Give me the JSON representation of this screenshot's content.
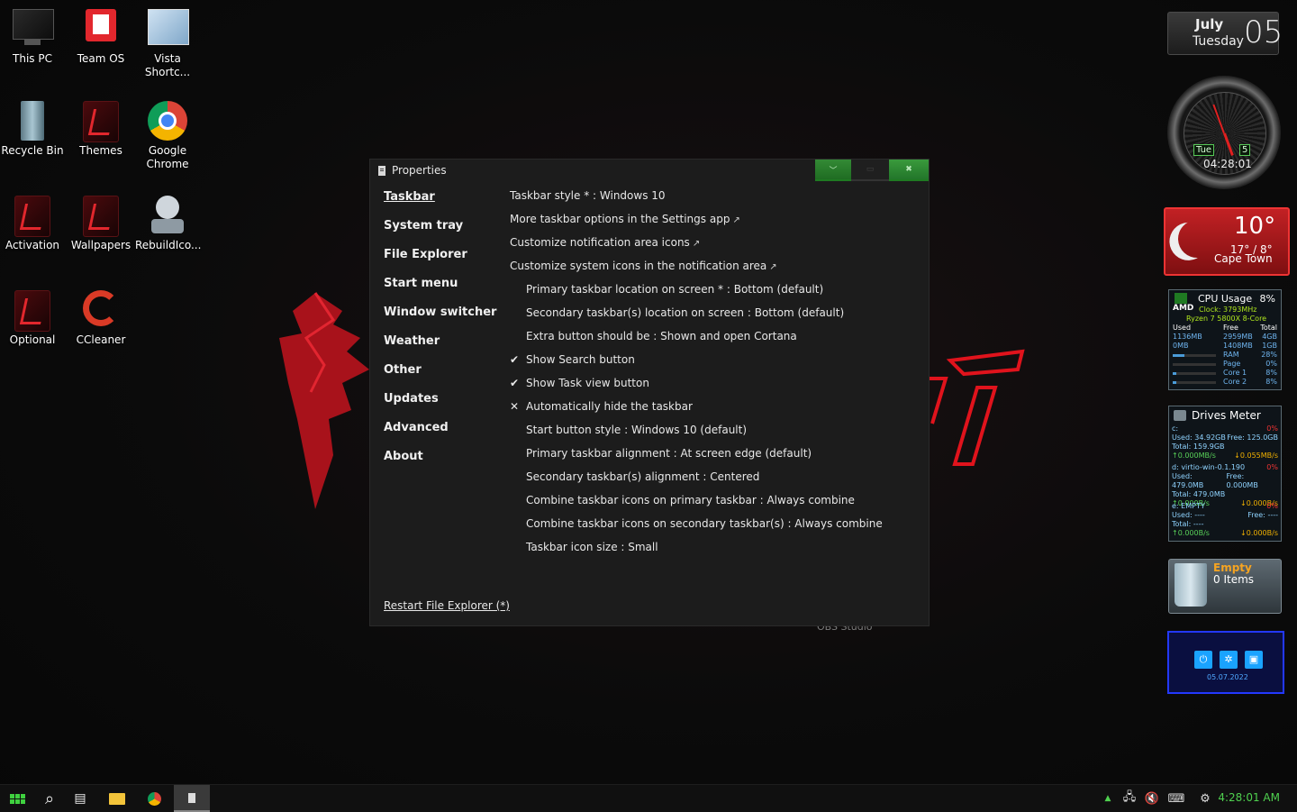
{
  "desktop": {
    "icons": [
      {
        "label": "This PC",
        "icon": "monitor-icon"
      },
      {
        "label": "Team OS",
        "icon": "team-os-icon"
      },
      {
        "label": "Vista Shortc...",
        "icon": "vista-shortcut-icon"
      },
      {
        "label": "Recycle Bin",
        "icon": "recycle-bin-icon"
      },
      {
        "label": "Themes",
        "icon": "themes-icon"
      },
      {
        "label": "Google Chrome",
        "icon": "chrome-icon"
      },
      {
        "label": "Activation",
        "icon": "activation-icon"
      },
      {
        "label": "Wallpapers",
        "icon": "wallpapers-icon"
      },
      {
        "label": "RebuildIco...",
        "icon": "rebuild-icon"
      },
      {
        "label": "Optional",
        "icon": "optional-icon"
      },
      {
        "label": "CCleaner",
        "icon": "ccleaner-icon"
      }
    ],
    "obs_label": "OBS Studio"
  },
  "dialog": {
    "title": "Properties",
    "nav": [
      "Taskbar",
      "System tray",
      "File Explorer",
      "Start menu",
      "Window switcher",
      "Weather",
      "Other",
      "Updates",
      "Advanced",
      "About"
    ],
    "active_nav": "Taskbar",
    "options": [
      {
        "text": "Taskbar style * : Windows 10",
        "link": false,
        "indent": false,
        "mark": ""
      },
      {
        "text": "More taskbar options in the Settings app",
        "link": true,
        "indent": false,
        "mark": ""
      },
      {
        "text": "Customize notification area icons",
        "link": true,
        "indent": false,
        "mark": ""
      },
      {
        "text": "Customize system icons in the notification area",
        "link": true,
        "indent": false,
        "mark": ""
      },
      {
        "text": "Primary taskbar location on screen * : Bottom (default)",
        "link": false,
        "indent": true,
        "mark": ""
      },
      {
        "text": "Secondary taskbar(s) location on screen : Bottom (default)",
        "link": false,
        "indent": true,
        "mark": ""
      },
      {
        "text": "Extra button should be : Shown and open Cortana",
        "link": false,
        "indent": true,
        "mark": ""
      },
      {
        "text": "Show Search button",
        "link": false,
        "indent": true,
        "mark": "✔"
      },
      {
        "text": "Show Task view button",
        "link": false,
        "indent": true,
        "mark": "✔"
      },
      {
        "text": "Automatically hide the taskbar",
        "link": false,
        "indent": true,
        "mark": "✕"
      },
      {
        "text": "Start button style : Windows 10 (default)",
        "link": false,
        "indent": true,
        "mark": ""
      },
      {
        "text": "Primary taskbar alignment : At screen edge (default)",
        "link": false,
        "indent": true,
        "mark": ""
      },
      {
        "text": "Secondary taskbar(s) alignment : Centered",
        "link": false,
        "indent": true,
        "mark": ""
      },
      {
        "text": "Combine taskbar icons on primary taskbar : Always combine",
        "link": false,
        "indent": true,
        "mark": ""
      },
      {
        "text": "Combine taskbar icons on secondary taskbar(s) : Always combine",
        "link": false,
        "indent": true,
        "mark": ""
      },
      {
        "text": "Taskbar icon size : Small",
        "link": false,
        "indent": true,
        "mark": ""
      }
    ],
    "restart_link": "Restart File Explorer (*)",
    "ext_glyph": "↗"
  },
  "widgets": {
    "date": {
      "month": "July",
      "weekday": "Tuesday",
      "day": "05"
    },
    "clock": {
      "day": "Tue",
      "num": "5",
      "time": "04:28:01"
    },
    "weather": {
      "temp": "10°",
      "range": "17° / 8°",
      "city": "Cape Town"
    },
    "cpu": {
      "title": "CPU Usage",
      "percent": "8%",
      "brand": "AMD",
      "clock": "Clock: 3793MHz",
      "model": "Ryzen 7 5800X 8-Core",
      "header": [
        "Used",
        "Free",
        "Total"
      ],
      "rows": [
        {
          "used": "1136MB",
          "free": "2959MB",
          "total": "4GB"
        },
        {
          "used": "0MB",
          "free": "1408MB",
          "total": "1GB"
        }
      ],
      "meters": [
        {
          "name": "RAM",
          "value": "28%",
          "fill": 0.28
        },
        {
          "name": "Page",
          "value": "0%",
          "fill": 0
        },
        {
          "name": "Core 1",
          "value": "8%",
          "fill": 0.08
        },
        {
          "name": "Core 2",
          "value": "8%",
          "fill": 0.08
        }
      ]
    },
    "drives": {
      "title": "Drives Meter",
      "list": [
        {
          "name": "c:",
          "pct": "0%",
          "used": "Used: 34.92GB",
          "free": "Free: 125.0GB",
          "total": "Total: 159.9GB",
          "up": "0.000MB/s",
          "down": "0.055MB/s"
        },
        {
          "name": "d: virtio-win-0.1.190",
          "pct": "0%",
          "used": "Used: 479.0MB",
          "free": "Free: 0.000MB",
          "total": "Total: 479.0MB",
          "up": "0.000B/s",
          "down": "0.000B/s"
        },
        {
          "name": "e: EMPTY",
          "pct": "0%",
          "used": "Used: ----",
          "free": "Free: ----",
          "total": "Total: ----",
          "up": "0.000B/s",
          "down": "0.000B/s"
        }
      ]
    },
    "bin": {
      "status": "Empty",
      "items": "0 Items"
    },
    "power": {
      "date": "05.07.2022"
    }
  },
  "taskbar": {
    "buttons": [
      "start-icon",
      "search-icon",
      "task-view-icon",
      "file-explorer-icon",
      "chrome-icon",
      "properties-app-icon"
    ],
    "active": "properties-app-icon",
    "clock": "4:28:01 AM",
    "accent": "#4fd14f"
  }
}
